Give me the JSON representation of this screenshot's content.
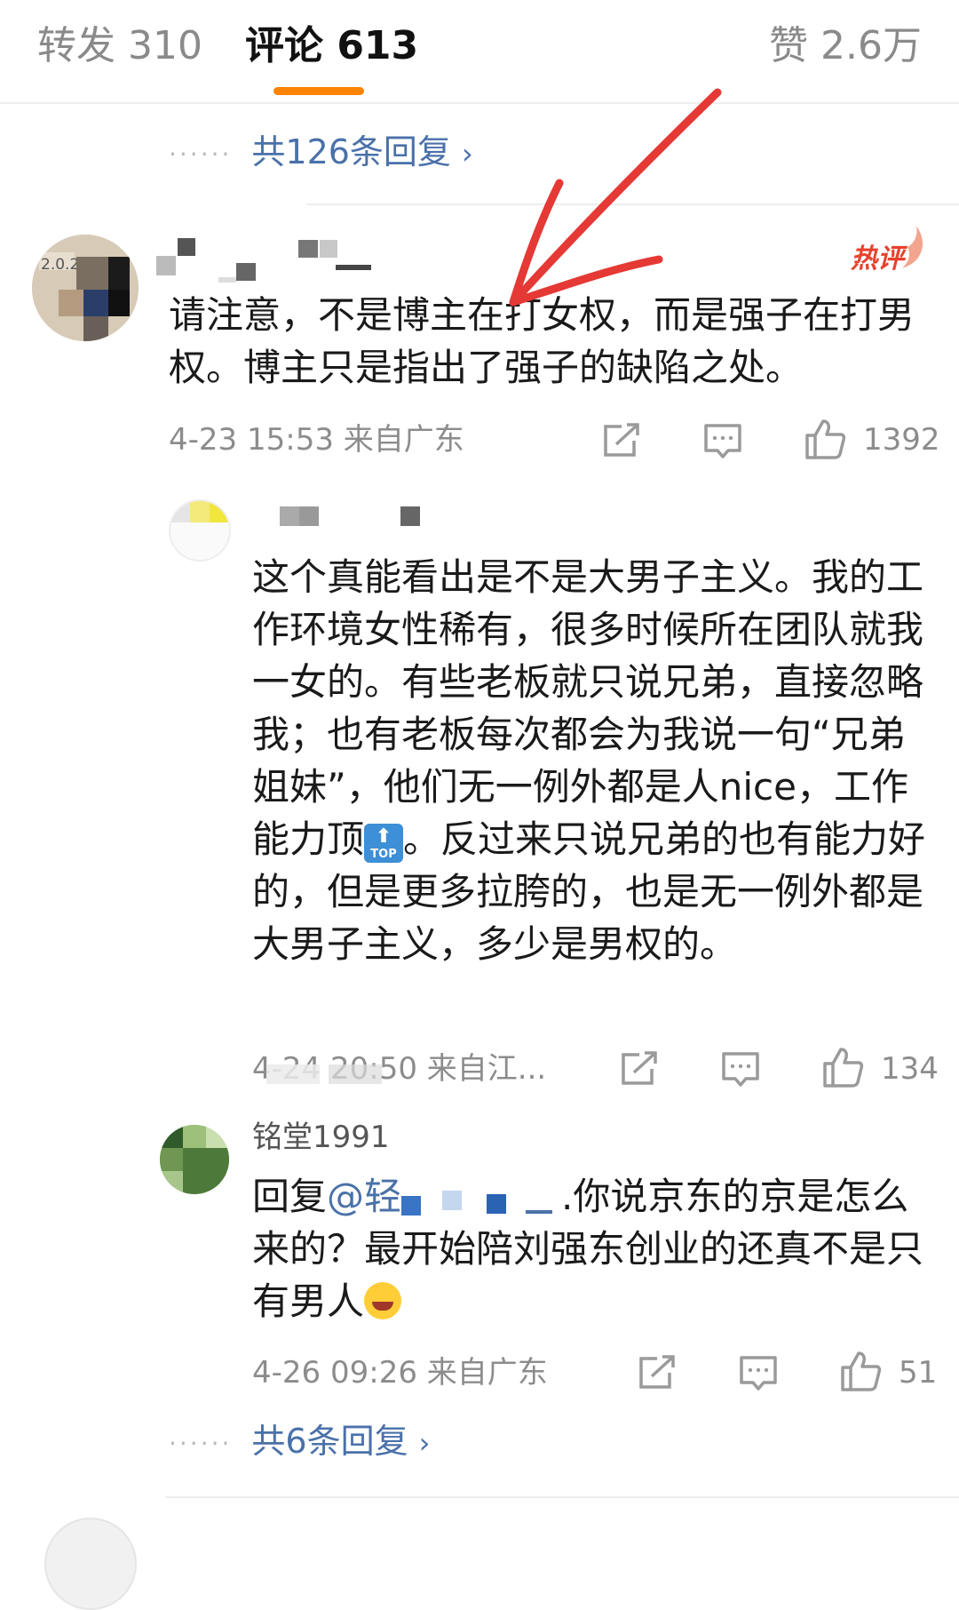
{
  "tabs": {
    "forward": "转发 310",
    "comments": "评论 613",
    "likes": "赞 2.6万"
  },
  "top_replies_link": "共126条回复",
  "comment1": {
    "badge": "热评",
    "text": "请注意，不是博主在打女权，而是强子在打男权。博主只是指出了强子的缺陷之处。",
    "time_location": "4-23 15:53 来自广东",
    "like_count": "1392"
  },
  "reply1": {
    "text_before_emoji": "这个真能看出是不是大男子主义。我的工作环境女性稀有，很多时候所在团队就我一女的。有些老板就只说兄弟，直接忽略我；也有老板每次都会为我说一句“兄弟姐妹”，他们无一例外都是人nice，工作能力顶",
    "text_after_emoji": "。反过来只说兄弟的也有能力好的，但是更多拉胯的，也是无一例外都是大男子主义，多少是男权的。",
    "emoji_label": "TOP",
    "time_location": "4-24 20:50 来自江...",
    "like_count": "134"
  },
  "reply2": {
    "username": "铭堂1991",
    "reply_prefix": "回复",
    "mention": "@轻",
    "text": ".你说京东的京是怎么来的？最开始陪刘强东创业的还真不是只有男人",
    "time_location": "4-26 09:26 来自广东",
    "like_count": "51"
  },
  "bottom_replies_link": "共6条回复",
  "colors": {
    "accent_orange": "#ff8200",
    "link_blue": "#4a71a9",
    "hot_red": "#e8422d",
    "annotation_red": "#e53935"
  },
  "icons": [
    "share-icon",
    "comment-icon",
    "thumbs-up-icon",
    "chevron-right-icon",
    "flame-icon"
  ]
}
